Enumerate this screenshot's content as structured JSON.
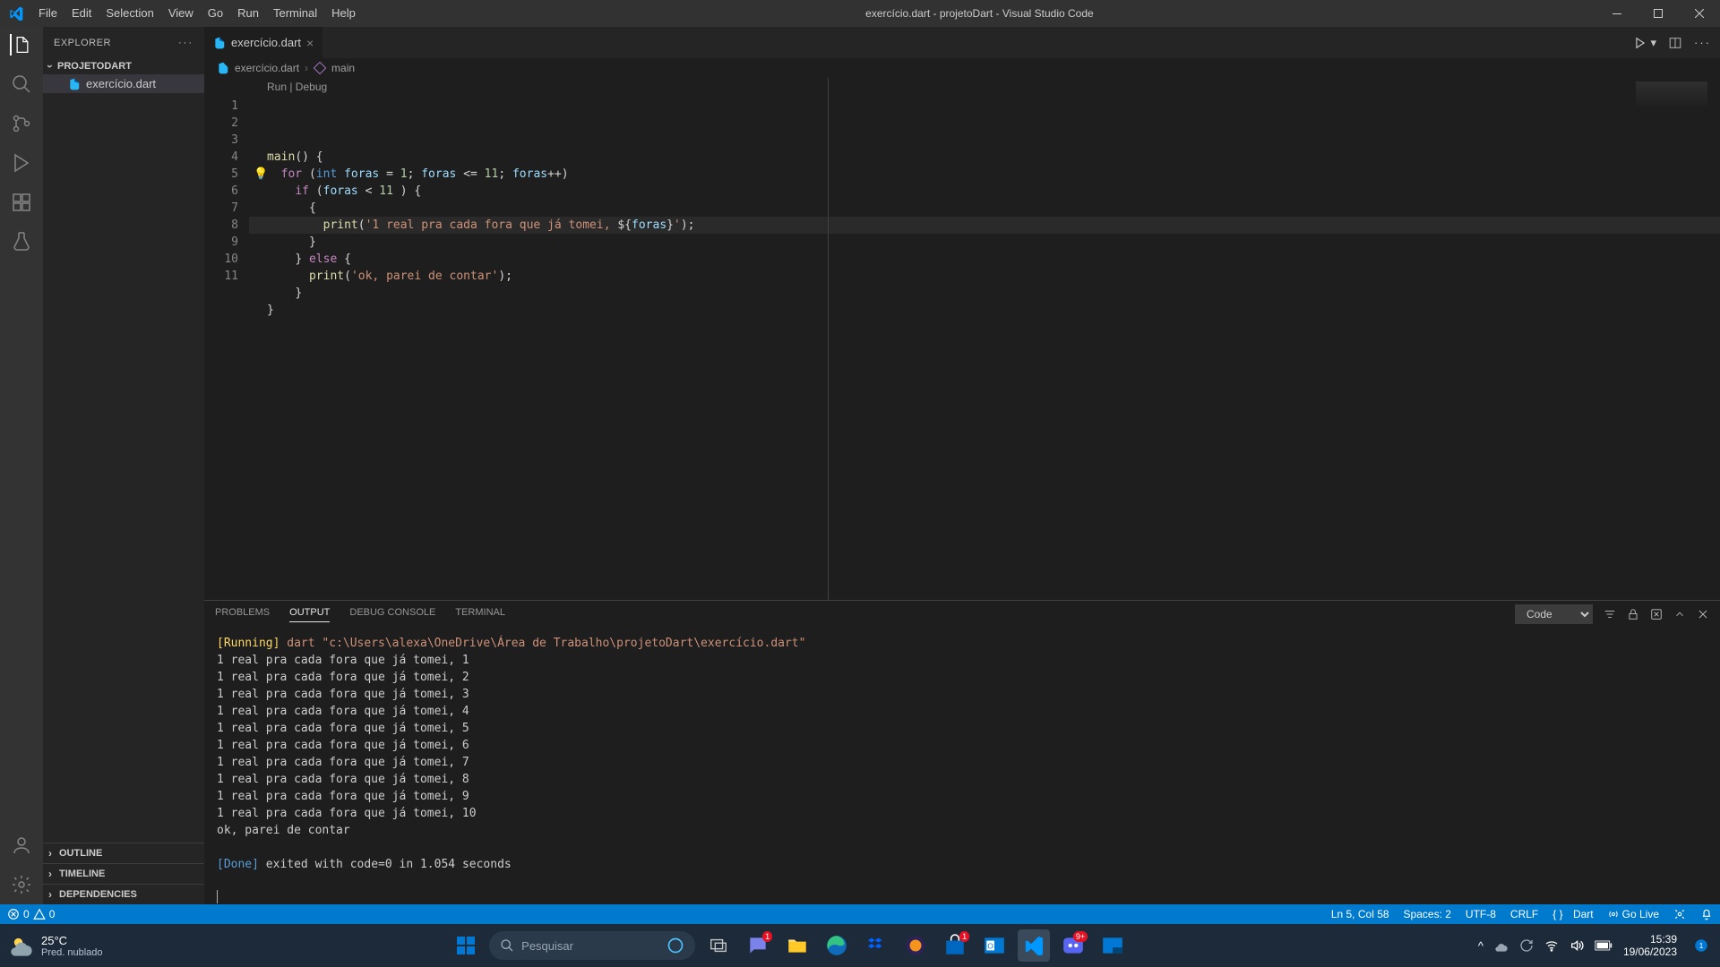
{
  "titlebar": {
    "menus": [
      "File",
      "Edit",
      "Selection",
      "View",
      "Go",
      "Run",
      "Terminal",
      "Help"
    ],
    "title": "exercício.dart - projetoDart - Visual Studio Code"
  },
  "sidebar": {
    "header": "EXPLORER",
    "project": "PROJETODART",
    "file": "exercício.dart",
    "sections": [
      "OUTLINE",
      "TIMELINE",
      "DEPENDENCIES"
    ]
  },
  "tab": {
    "name": "exercício.dart"
  },
  "breadcrumb": {
    "file": "exercício.dart",
    "symbol": "main"
  },
  "codelens": "Run | Debug",
  "code": {
    "lines": [
      {
        "n": 1,
        "html": "<span class='fn'>main</span><span class='punct'>() {</span>"
      },
      {
        "n": 2,
        "html": "  <span class='kw'>for</span> <span class='punct'>(</span><span class='type'>int</span> <span class='var'>foras</span> <span class='punct'>=</span> <span class='num'>1</span><span class='punct'>;</span> <span class='var'>foras</span> <span class='punct'>&lt;=</span> <span class='num'>11</span><span class='punct'>;</span> <span class='var'>foras</span><span class='punct'>++)</span>"
      },
      {
        "n": 3,
        "html": "    <span class='kw'>if</span> <span class='punct'>(</span><span class='var'>foras</span> <span class='punct'>&lt;</span> <span class='num'>11</span> <span class='punct'>) {</span>"
      },
      {
        "n": 4,
        "html": "      <span class='punct'>{</span>"
      },
      {
        "n": 5,
        "html": "        <span class='fn'>print</span><span class='punct'>(</span><span class='str'>'1 real pra cada fora que já tomei, </span><span class='punct'>${</span><span class='interp'>foras</span><span class='punct'>}</span><span class='str'>'</span><span class='punct'>);</span>",
        "active": true
      },
      {
        "n": 6,
        "html": "      <span class='punct'>}</span>"
      },
      {
        "n": 7,
        "html": "    <span class='punct'>}</span> <span class='kw'>else</span> <span class='punct'>{</span>"
      },
      {
        "n": 8,
        "html": "      <span class='fn'>print</span><span class='punct'>(</span><span class='str'>'ok, parei de contar'</span><span class='punct'>);</span>"
      },
      {
        "n": 9,
        "html": "    <span class='punct'>}</span>"
      },
      {
        "n": 10,
        "html": "<span class='punct'>}</span>"
      },
      {
        "n": 11,
        "html": ""
      }
    ]
  },
  "panel": {
    "tabs": [
      "PROBLEMS",
      "OUTPUT",
      "DEBUG CONSOLE",
      "TERMINAL"
    ],
    "active_tab": "OUTPUT",
    "selector": "Code",
    "output": {
      "running_label": "[Running]",
      "running_cmd": "dart \"c:\\Users\\alexa\\OneDrive\\Área de Trabalho\\projetoDart\\exercício.dart\"",
      "lines": [
        "1 real pra cada fora que já tomei, 1",
        "1 real pra cada fora que já tomei, 2",
        "1 real pra cada fora que já tomei, 3",
        "1 real pra cada fora que já tomei, 4",
        "1 real pra cada fora que já tomei, 5",
        "1 real pra cada fora que já tomei, 6",
        "1 real pra cada fora que já tomei, 7",
        "1 real pra cada fora que já tomei, 8",
        "1 real pra cada fora que já tomei, 9",
        "1 real pra cada fora que já tomei, 10",
        "ok, parei de contar"
      ],
      "done_label": "[Done]",
      "done_msg": "exited with code=0 in 1.054 seconds"
    }
  },
  "statusbar": {
    "errors": "0",
    "warnings": "0",
    "ln_col": "Ln 5, Col 58",
    "spaces": "Spaces: 2",
    "encoding": "UTF-8",
    "eol": "CRLF",
    "lang": "Dart",
    "golive": "Go Live"
  },
  "taskbar": {
    "temp": "25°C",
    "weather_desc": "Pred. nublado",
    "search_placeholder": "Pesquisar",
    "time": "15:39",
    "date": "19/06/2023"
  }
}
